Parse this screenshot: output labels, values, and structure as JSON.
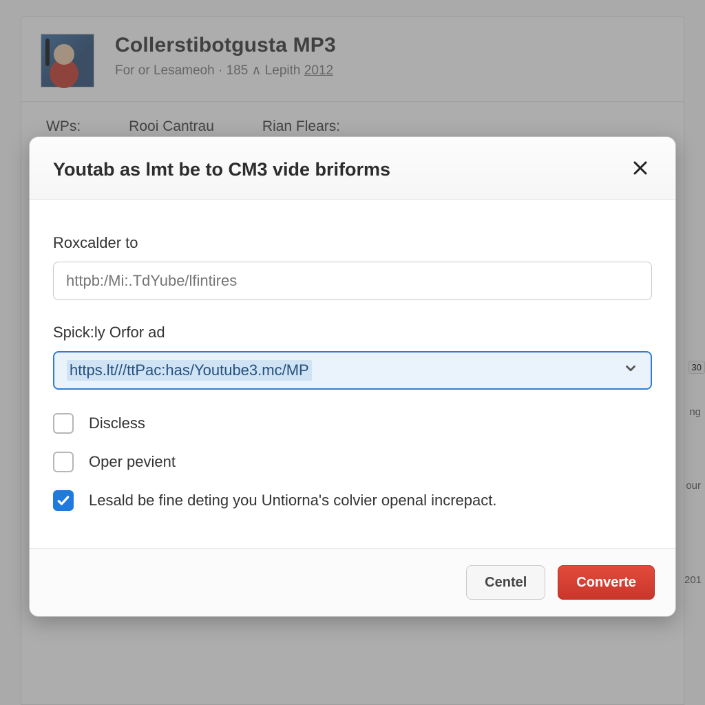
{
  "background": {
    "title": "Collerstibotgusta MP3",
    "subtitle_prefix": "For or Lesameoh · 185 ∧ Lepith ",
    "subtitle_year": "2012",
    "tabs": [
      "WPs:",
      "Rooi Cantrau",
      "Rian Flears:"
    ],
    "right_hints": {
      "badge": "30",
      "t1": "ng",
      "t2": "our",
      "t3": "201"
    }
  },
  "modal": {
    "title": "Youtab as lmt be to CM3 vide briforms",
    "field1": {
      "label": "Roxcalder to",
      "placeholder": "httpb:/Mi:.TdYube/lfintires"
    },
    "field2": {
      "label": "Spick:ly Orfor ad",
      "value": "https.lt///ttPac:has/Youtube3.mc/MP"
    },
    "checks": [
      {
        "label": "Discless",
        "checked": false
      },
      {
        "label": "Oper pevient",
        "checked": false
      },
      {
        "label": "Lesald be fine deting you Untiorna's colvier openal increpact.",
        "checked": true
      }
    ],
    "buttons": {
      "cancel": "Centel",
      "confirm": "Converte"
    }
  }
}
